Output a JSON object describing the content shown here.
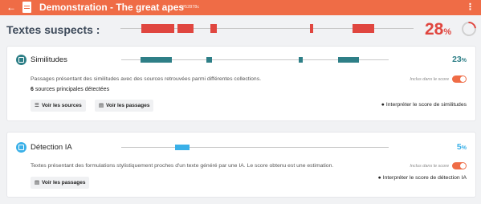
{
  "header": {
    "back_icon": "arrow-left-icon",
    "doc_icon": "document-icon",
    "title": "Demonstration - The great apes",
    "tag": "#52878c",
    "menu_icon": "kebab-menu-icon",
    "color": "#ef6c46"
  },
  "suspect": {
    "title": "Textes suspects :",
    "value": "28",
    "symbol": "%",
    "score_fraction": 0.28,
    "color": "#e0463f"
  },
  "similarities": {
    "title": "Similitudes",
    "value": "23",
    "symbol": "%",
    "color": "#2e7f87",
    "description": "Passages présentant des similitudes avec des sources retrouvées parmi différentes collections.",
    "count": "6",
    "count_label": "sources principales détectées",
    "included_label": "Inclus dans le score",
    "included": true,
    "btn_sources": "Voir les sources",
    "btn_passages": "Voir les passages",
    "interpret": "Interpréter le score de similitudes"
  },
  "ai": {
    "title": "Détection IA",
    "value": "5",
    "symbol": "%",
    "color": "#3ab0e8",
    "description": "Textes présentant des formulations stylistiquement proches d'un texte généré par une IA. Le score obtenu est une estimation.",
    "included_label": "Inclus dans le score",
    "included": true,
    "btn_passages": "Voir les passages",
    "interpret": "Interpréter le score de détection IA"
  }
}
